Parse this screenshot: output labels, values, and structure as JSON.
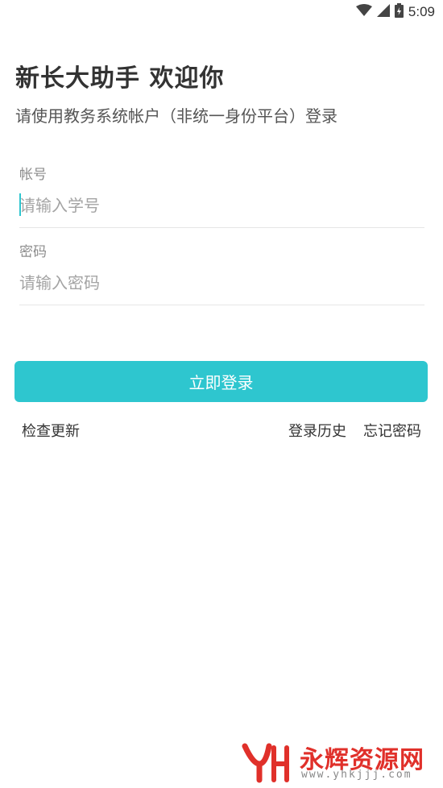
{
  "status_bar": {
    "time": "5:09",
    "icons": [
      "wifi-icon",
      "signal-icon",
      "battery-icon"
    ]
  },
  "header": {
    "title": "新长大助手 欢迎你",
    "subtitle": "请使用教务系统帐户（非统一身份平台）登录"
  },
  "form": {
    "account": {
      "label": "帐号",
      "placeholder": "请输入学号",
      "value": ""
    },
    "password": {
      "label": "密码",
      "placeholder": "请输入密码",
      "value": ""
    },
    "submit_label": "立即登录"
  },
  "links": {
    "check_update": "检查更新",
    "login_history": "登录历史",
    "forgot_password": "忘记密码"
  },
  "watermark": {
    "name": "永辉资源网",
    "url": "www.yhkjjj.com"
  },
  "colors": {
    "accent": "#2ec6cf",
    "watermark_red": "#e0302a"
  }
}
